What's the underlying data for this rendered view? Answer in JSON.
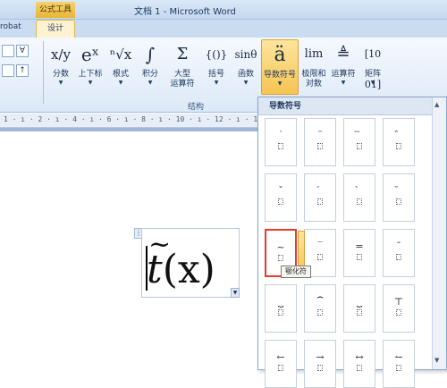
{
  "window": {
    "context_tab": "公式工具",
    "title": "文档 1 - Microsoft Word"
  },
  "tabs": {
    "acrobat": "robat",
    "design": "设计"
  },
  "left_controls": [
    "∀",
    "↑"
  ],
  "ribbon": {
    "buttons": [
      {
        "sym": "x/y",
        "label": "分数"
      },
      {
        "sym": "eˣ",
        "label": "上下标"
      },
      {
        "sym": "ⁿ√x",
        "label": "根式"
      },
      {
        "sym": "∫",
        "label": "积分"
      },
      {
        "sym": "Σ",
        "label": "大型",
        "label2": "运算符"
      },
      {
        "sym": "{()}",
        "label": "括号"
      },
      {
        "sym": "sinθ",
        "label": "函数"
      },
      {
        "sym": "ä",
        "label": "导数符号"
      },
      {
        "sym": "lim",
        "label": "极限和",
        "label2": "对数"
      },
      {
        "sym": "≜",
        "label": "运算符"
      },
      {
        "sym": "[10 01]",
        "label": "矩阵"
      }
    ],
    "group_label": "结构"
  },
  "ruler": {
    "text": "1 · ı · 2 · ı · 4 · ı · 6 · ı · 8 · ı · 10 · ı · 12 · ı · 14 · ı · 16 · ı ·"
  },
  "equation": {
    "base": "t",
    "accent": "~",
    "arg": "(x)"
  },
  "gallery": {
    "title": "导数符号",
    "tooltip": "颚化符",
    "rows": [
      [
        "˙",
        "¨",
        "⃛",
        "̂"
      ],
      [
        "ˇ",
        "́",
        "̀",
        "̆"
      ],
      [
        "~",
        "‾",
        "=",
        "¯"
      ],
      [
        "⏟",
        "⏞",
        "⏟",
        "⊤"
      ],
      [
        "←",
        "→",
        "↔",
        "↼"
      ]
    ]
  }
}
